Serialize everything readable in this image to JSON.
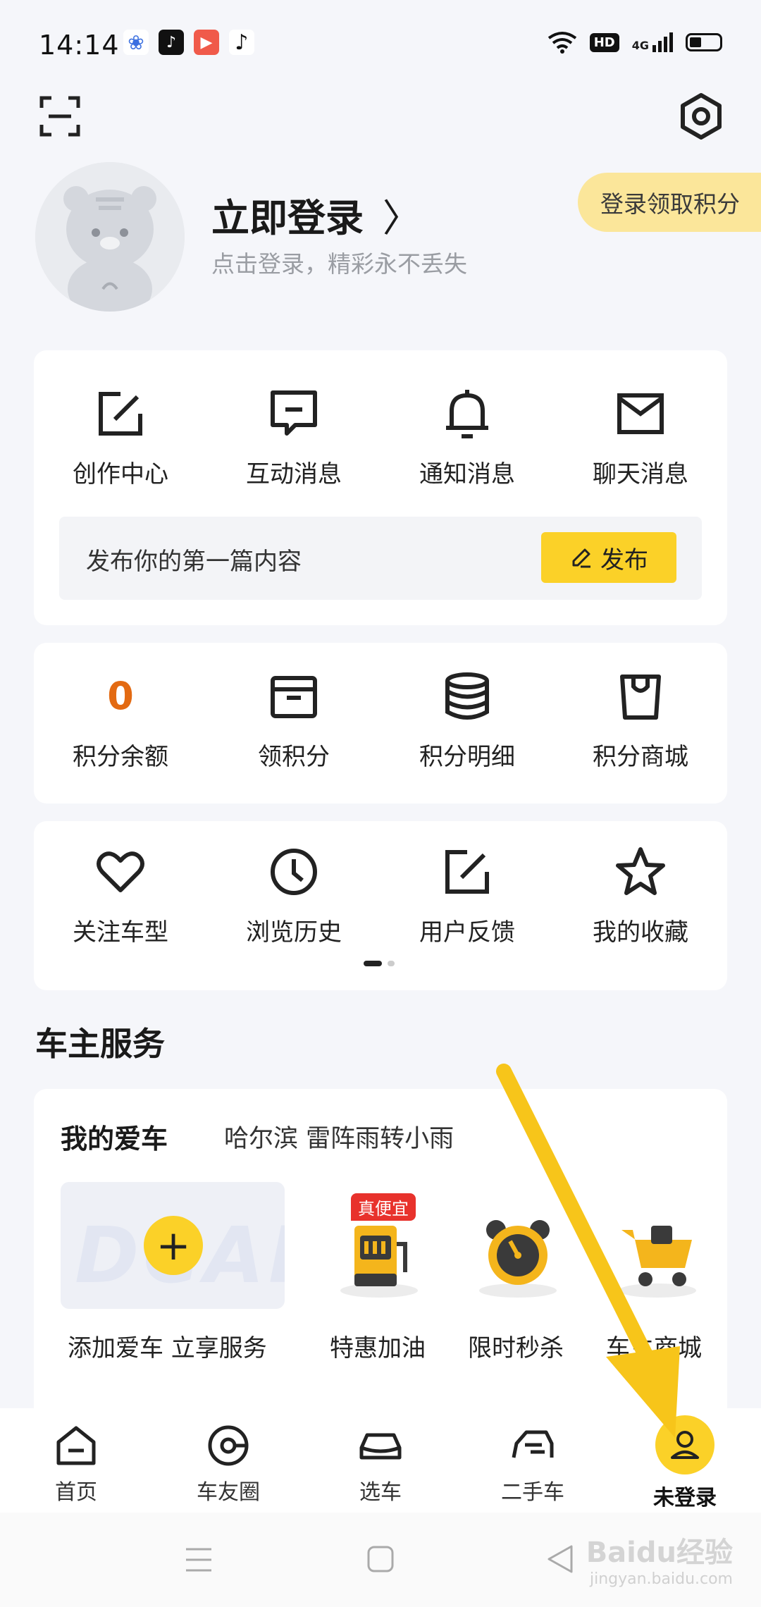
{
  "status_bar": {
    "time": "14:14",
    "hd": "HD",
    "network": "4G",
    "app_icons": [
      "baidu-paw-icon",
      "tiktok-lite-icon",
      "kuaishou-icon",
      "tiktok-icon"
    ]
  },
  "profile": {
    "title": "立即登录",
    "subtitle": "点击登录，精彩永不丢失",
    "points_pill": "登录领取积分"
  },
  "messages": {
    "items": [
      {
        "label": "创作中心",
        "icon": "edit-icon"
      },
      {
        "label": "互动消息",
        "icon": "chat-icon"
      },
      {
        "label": "通知消息",
        "icon": "bell-icon"
      },
      {
        "label": "聊天消息",
        "icon": "mail-icon"
      }
    ],
    "publish_prompt": "发布你的第一篇内容",
    "publish_button": "发布"
  },
  "points": {
    "balance": "0",
    "items": [
      {
        "label": "积分余额"
      },
      {
        "label": "领积分",
        "icon": "box-icon"
      },
      {
        "label": "积分明细",
        "icon": "database-icon"
      },
      {
        "label": "积分商城",
        "icon": "shopping-bag-icon"
      }
    ]
  },
  "tools": {
    "items": [
      {
        "label": "关注车型",
        "icon": "heart-icon"
      },
      {
        "label": "浏览历史",
        "icon": "clock-icon"
      },
      {
        "label": "用户反馈",
        "icon": "edit-icon"
      },
      {
        "label": "我的收藏",
        "icon": "star-icon"
      }
    ]
  },
  "owner_services": {
    "section_title": "车主服务",
    "my_car_title": "我的爱车",
    "weather": "哈尔滨  雷阵雨转小雨",
    "add_car_label": "添加爱车 立享服务",
    "services": [
      {
        "label": "特惠加油",
        "tag": "真便宜",
        "icon": "gas-pump-icon"
      },
      {
        "label": "限时秒杀",
        "icon": "alarm-clock-icon"
      },
      {
        "label": "车主商城",
        "icon": "shopping-cart-icon"
      }
    ]
  },
  "bottom_nav": [
    {
      "label": "首页",
      "icon": "home-icon"
    },
    {
      "label": "车友圈",
      "icon": "circle-icon"
    },
    {
      "label": "选车",
      "icon": "car-icon"
    },
    {
      "label": "二手车",
      "icon": "used-car-icon"
    },
    {
      "label": "未登录",
      "icon": "user-icon",
      "active": true
    }
  ],
  "watermark": {
    "text": "Baidu经验",
    "sub": "jingyan.baidu.com"
  },
  "colors": {
    "accent": "#fbd128",
    "points_orange": "#e36a12",
    "pill": "#fbe69a",
    "arrow": "#f7c51a"
  }
}
